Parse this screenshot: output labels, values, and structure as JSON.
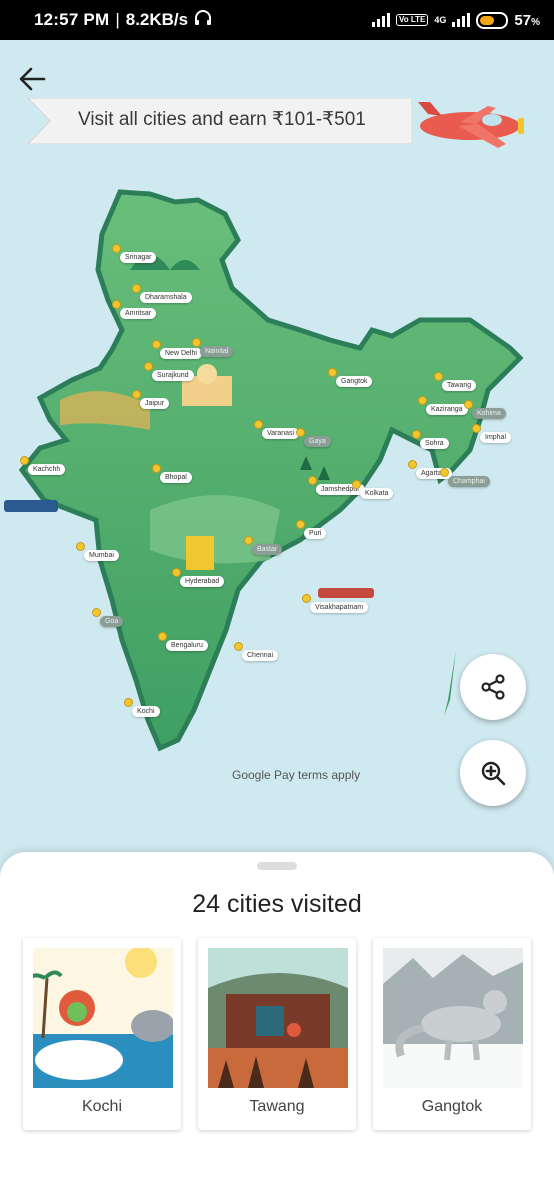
{
  "status_bar": {
    "time": "12:57 PM",
    "speed": "8.2KB/s",
    "headphone_icon": "headphones-icon",
    "volte": "Vo LTE",
    "network": "4G",
    "battery_percent": 57,
    "battery_label": "57"
  },
  "header": {
    "back_icon": "arrow-back-icon",
    "banner_text": "Visit all cities and earn ₹101-₹501"
  },
  "map": {
    "cities": [
      {
        "name": "Srinagar",
        "dim": false
      },
      {
        "name": "Dharamshala",
        "dim": false
      },
      {
        "name": "Amritsar",
        "dim": false
      },
      {
        "name": "New Delhi",
        "dim": false
      },
      {
        "name": "Nainital",
        "dim": true
      },
      {
        "name": "Surajkund",
        "dim": false
      },
      {
        "name": "Jaipur",
        "dim": false
      },
      {
        "name": "Varanasi",
        "dim": false
      },
      {
        "name": "Gaya",
        "dim": true
      },
      {
        "name": "Gangtok",
        "dim": false
      },
      {
        "name": "Tawang",
        "dim": false
      },
      {
        "name": "Kaziranga",
        "dim": false
      },
      {
        "name": "Kohima",
        "dim": true
      },
      {
        "name": "Imphal",
        "dim": false
      },
      {
        "name": "Sohra",
        "dim": false
      },
      {
        "name": "Agartala",
        "dim": false
      },
      {
        "name": "Champhai",
        "dim": true
      },
      {
        "name": "Kachchh",
        "dim": false
      },
      {
        "name": "Bhopal",
        "dim": false
      },
      {
        "name": "Jamshedpur",
        "dim": false
      },
      {
        "name": "Kolkata",
        "dim": false
      },
      {
        "name": "Mumbai",
        "dim": false
      },
      {
        "name": "Puri",
        "dim": false
      },
      {
        "name": "Bastar",
        "dim": true
      },
      {
        "name": "Hyderabad",
        "dim": false
      },
      {
        "name": "Visakhapatnam",
        "dim": false
      },
      {
        "name": "Goa",
        "dim": true
      },
      {
        "name": "Bengaluru",
        "dim": false
      },
      {
        "name": "Chennai",
        "dim": false
      },
      {
        "name": "Kochi",
        "dim": false
      }
    ],
    "terms": "Google Pay terms apply",
    "share_icon": "share-icon",
    "zoom_icon": "zoom-in-icon"
  },
  "sheet": {
    "title": "24 cities visited",
    "cards": [
      {
        "name": "Kochi"
      },
      {
        "name": "Tawang"
      },
      {
        "name": "Gangtok"
      }
    ]
  },
  "colors": {
    "ocean": "#cfe9f1",
    "land": "#5ab36e",
    "land_dark": "#2f8a5a",
    "coin": "#f2c62f"
  }
}
